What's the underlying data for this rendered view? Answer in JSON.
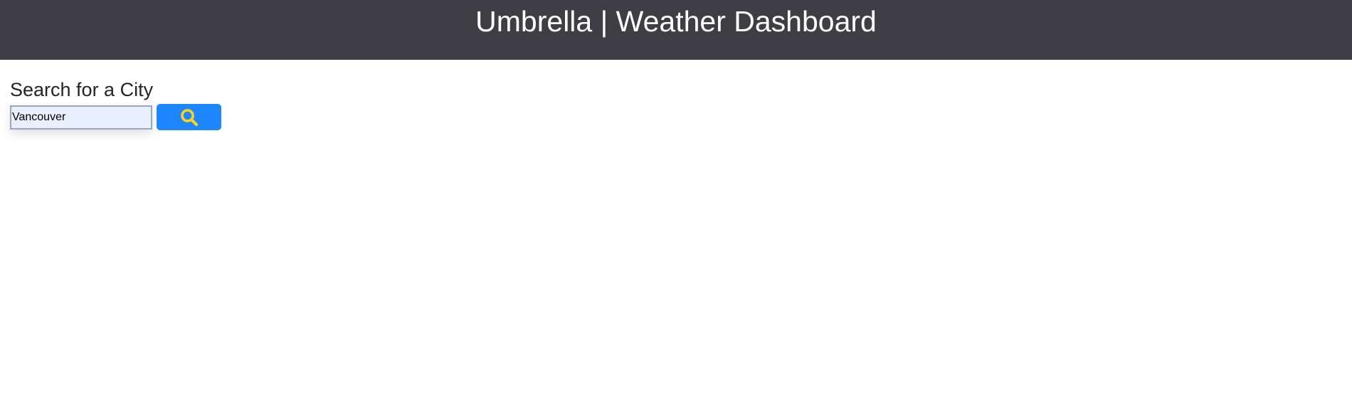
{
  "header": {
    "title": "Umbrella | Weather Dashboard"
  },
  "search": {
    "heading": "Search for a City",
    "value": "Vancouver",
    "button_icon": "search-icon"
  },
  "colors": {
    "header_bg": "#3f3e45",
    "button_bg": "#1e87ff",
    "icon": "#ffd21f"
  }
}
